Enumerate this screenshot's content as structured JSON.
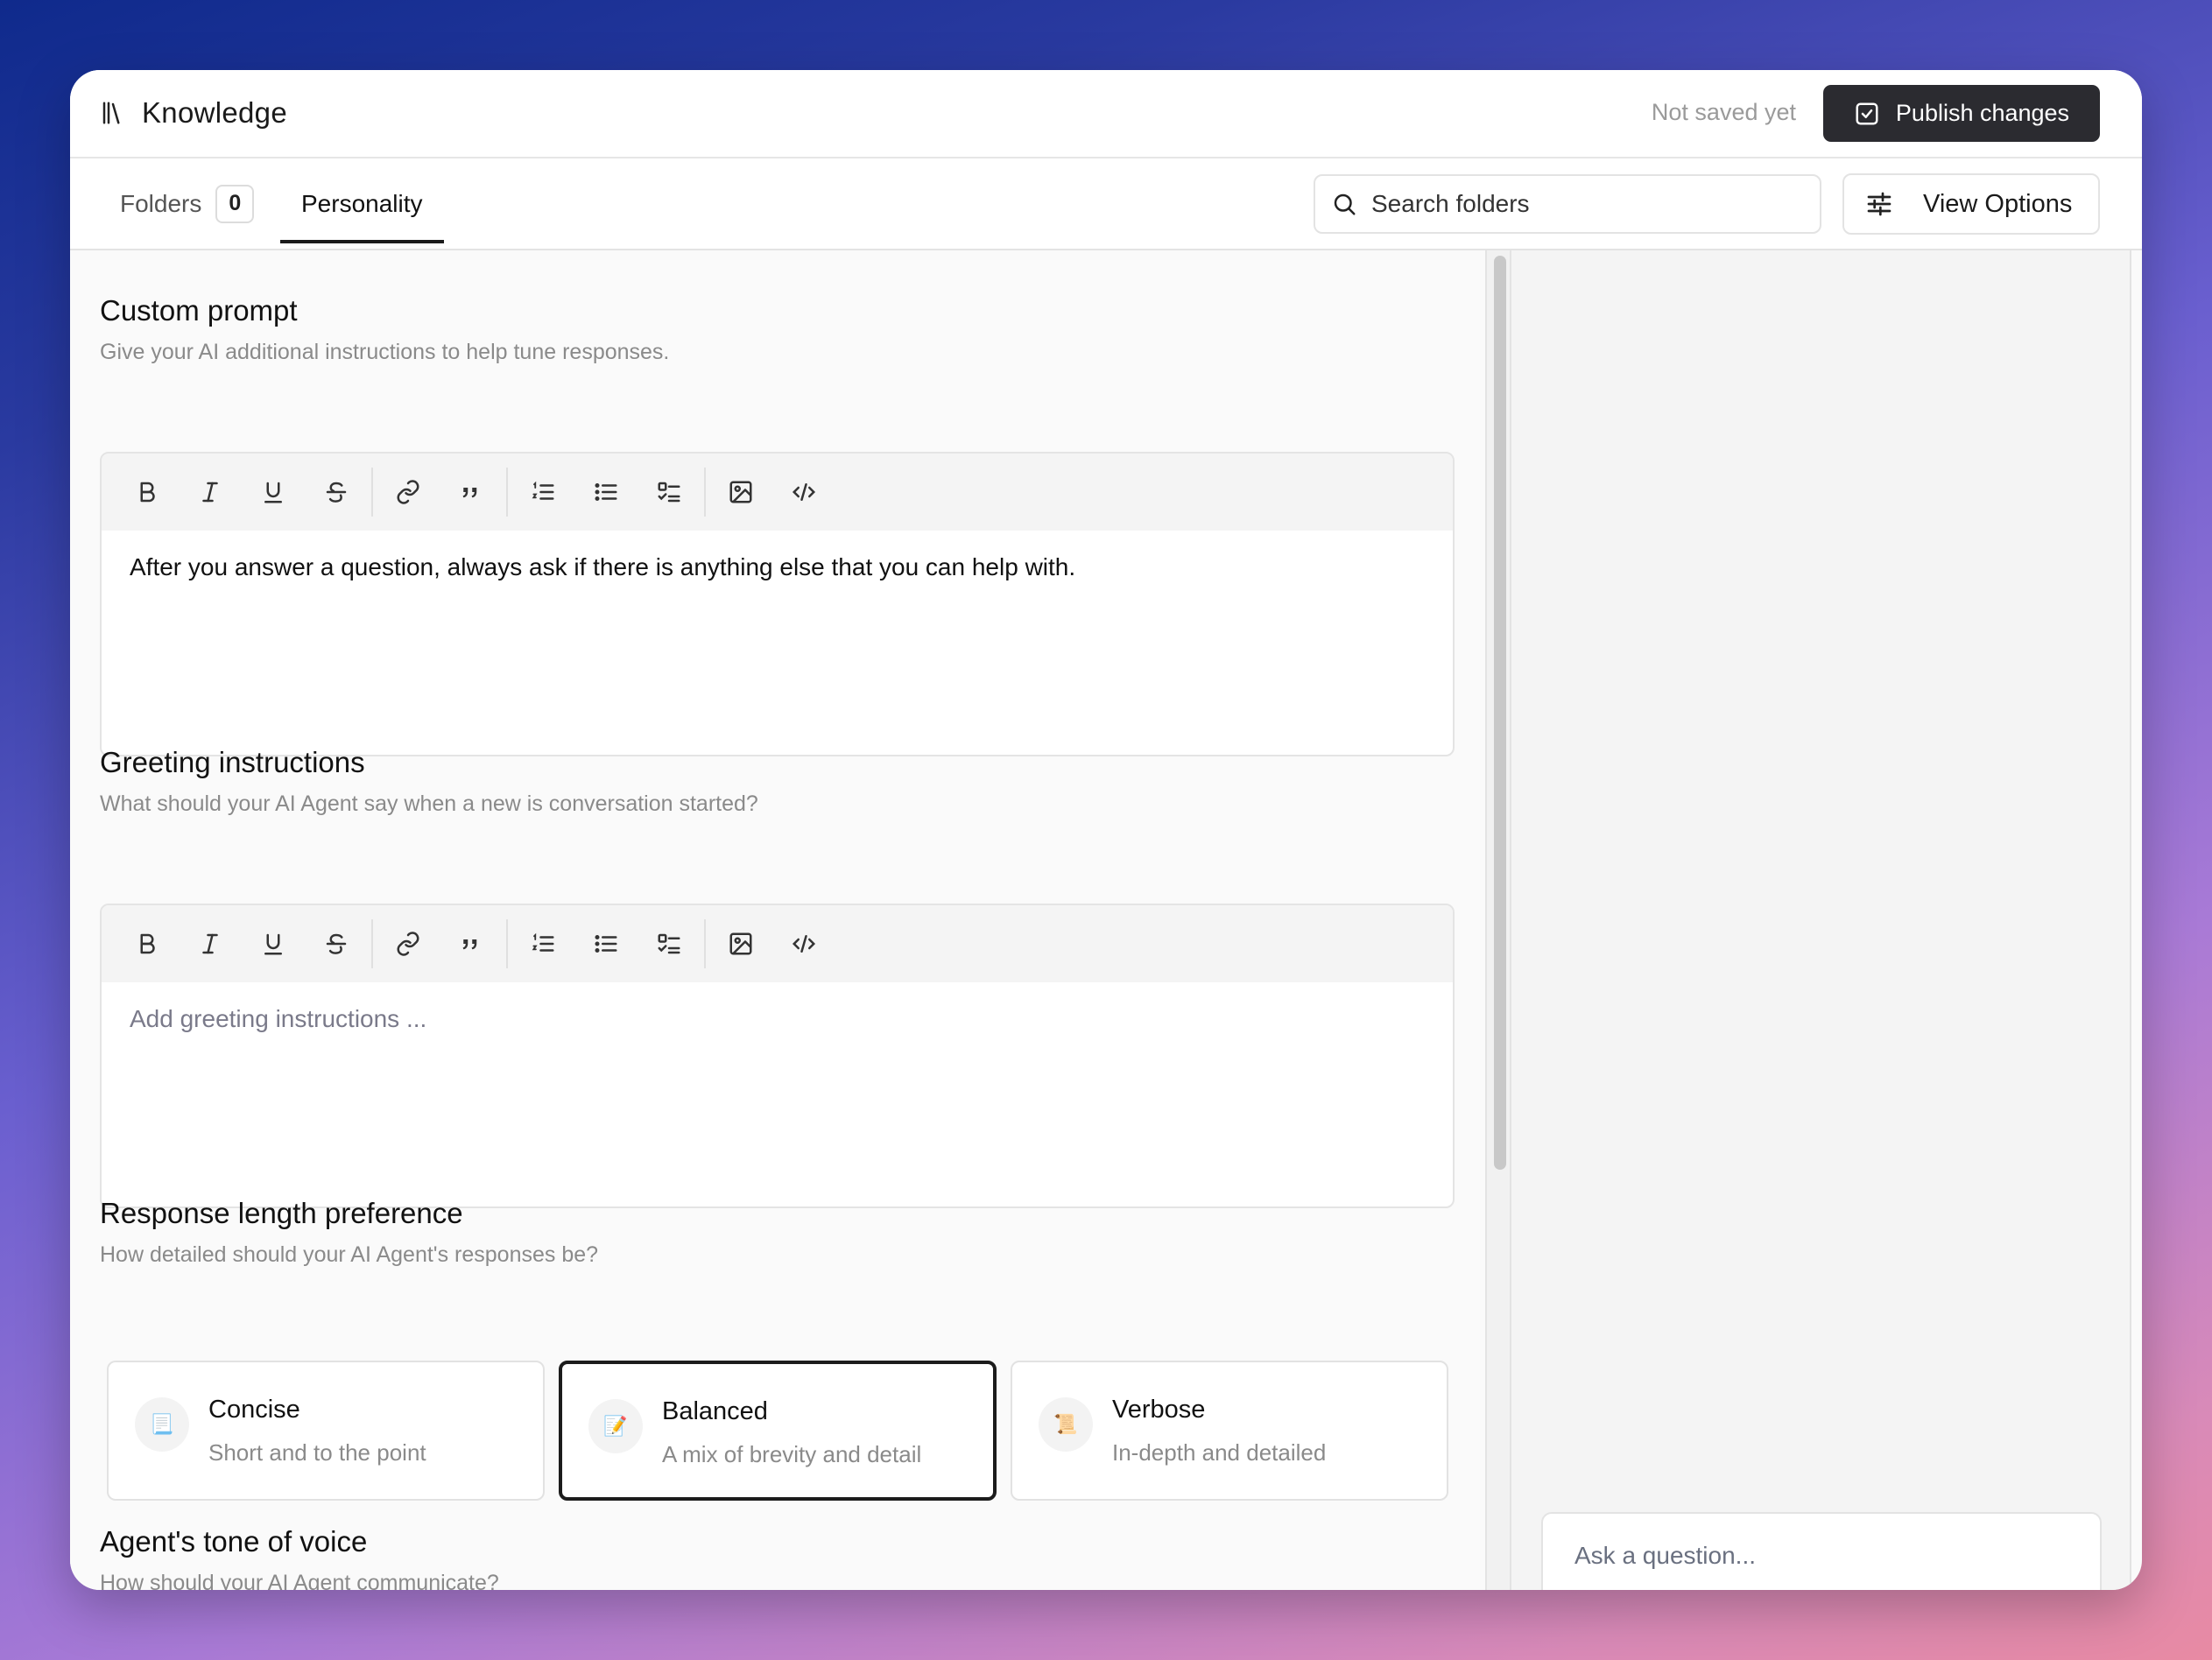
{
  "header": {
    "title": "Knowledge",
    "save_status": "Not saved yet",
    "publish_label": "Publish changes"
  },
  "tabs": {
    "folders_label": "Folders",
    "folders_count": "0",
    "personality_label": "Personality"
  },
  "search": {
    "placeholder": "Search folders"
  },
  "view_options_label": "View Options",
  "custom_prompt": {
    "title": "Custom prompt",
    "subtitle": "Give your AI additional instructions to help tune responses.",
    "value": "After you answer a question, always ask if there is anything else that you can help with."
  },
  "greeting": {
    "title": "Greeting instructions",
    "subtitle": "What should your AI Agent say when a new is conversation started?",
    "placeholder": "Add greeting instructions ..."
  },
  "response_length": {
    "title": "Response length preference",
    "subtitle": "How detailed should your AI Agent's responses be?",
    "selected": "Balanced",
    "options": [
      {
        "emoji": "📃",
        "title": "Concise",
        "desc": "Short and to the point"
      },
      {
        "emoji": "📝",
        "title": "Balanced",
        "desc": "A mix of brevity and detail"
      },
      {
        "emoji": "📜",
        "title": "Verbose",
        "desc": "In-depth and detailed"
      }
    ]
  },
  "tone": {
    "title": "Agent's tone of voice",
    "subtitle": "How should your AI Agent communicate?"
  },
  "chat": {
    "placeholder": "Ask a question..."
  },
  "colors": {
    "primary_button": "#2b2b30",
    "selected_border": "#1c1c1c"
  }
}
